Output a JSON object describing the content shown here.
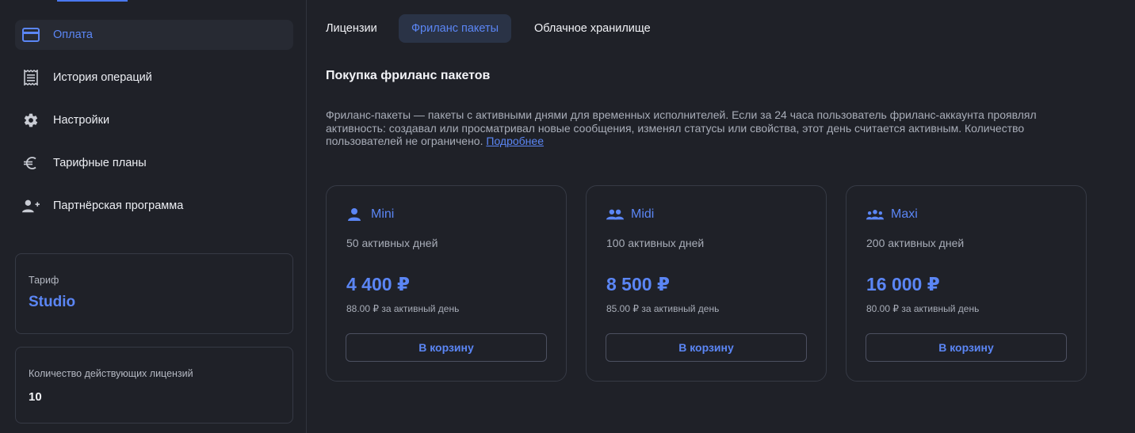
{
  "sidebar": {
    "items": [
      {
        "label": "Оплата",
        "icon": "credit-card-icon",
        "active": true
      },
      {
        "label": "История операций",
        "icon": "receipt-icon"
      },
      {
        "label": "Настройки",
        "icon": "gear-icon"
      },
      {
        "label": "Тарифные планы",
        "icon": "euro-icon"
      },
      {
        "label": "Партнёрская программа",
        "icon": "add-user-icon"
      }
    ],
    "plan": {
      "caption": "Тариф",
      "value": "Studio"
    },
    "licenses": {
      "caption": "Количество действующих лицензий",
      "value": "10"
    }
  },
  "tabs": [
    {
      "label": "Лицензии"
    },
    {
      "label": "Фриланс пакеты",
      "active": true
    },
    {
      "label": "Облачное хранилище"
    }
  ],
  "section": {
    "title": "Покупка фриланс пакетов",
    "description": "Фриланс-пакеты — пакеты с активными днями для временных исполнителей. Если за 24 часа пользователь фриланс-аккаунта проявлял активность: создавал или просматривал новые сообщения, изменял статусы или свойства, этот день считается активным. Количество пользователей не ограничено.",
    "more_link": "Подробнее"
  },
  "packages": [
    {
      "name": "Mini",
      "icon": "person-icon",
      "days": "50 активных дней",
      "price": "4 400 ₽",
      "per_day": "88.00 ₽ за активный день",
      "button": "В корзину"
    },
    {
      "name": "Midi",
      "icon": "people-icon",
      "days": "100 активных дней",
      "price": "8 500 ₽",
      "per_day": "85.00 ₽ за активный день",
      "button": "В корзину"
    },
    {
      "name": "Maxi",
      "icon": "group-icon",
      "days": "200 активных дней",
      "price": "16 000 ₽",
      "per_day": "80.00 ₽ за активный день",
      "button": "В корзину"
    }
  ],
  "colors": {
    "accent": "#5b86f5",
    "background": "#1f2128",
    "border": "#363a45"
  }
}
